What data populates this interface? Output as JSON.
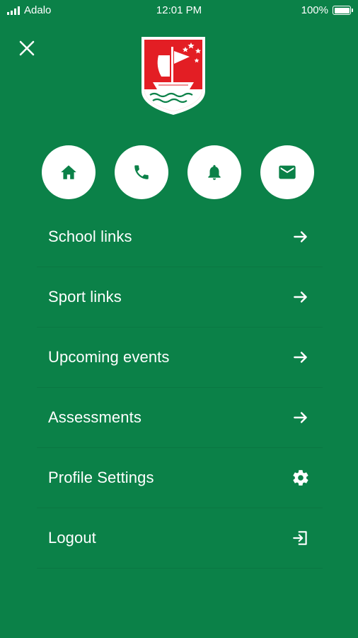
{
  "status_bar": {
    "carrier": "Adalo",
    "time": "12:01 PM",
    "battery": "100%"
  },
  "header": {
    "close_icon": "close-icon",
    "logo": "school-crest-logo"
  },
  "quick_actions": [
    {
      "icon": "home-icon"
    },
    {
      "icon": "phone-icon"
    },
    {
      "icon": "bell-icon"
    },
    {
      "icon": "mail-icon"
    }
  ],
  "menu": {
    "items": [
      {
        "label": "School links",
        "icon": "arrow-right-icon"
      },
      {
        "label": "Sport links",
        "icon": "arrow-right-icon"
      },
      {
        "label": "Upcoming events",
        "icon": "arrow-right-icon"
      },
      {
        "label": "Assessments",
        "icon": "arrow-right-icon"
      },
      {
        "label": "Profile Settings",
        "icon": "gear-icon"
      },
      {
        "label": "Logout",
        "icon": "logout-icon"
      }
    ]
  },
  "colors": {
    "background": "#0b8148",
    "crest_red": "#e31e24",
    "white": "#ffffff"
  }
}
